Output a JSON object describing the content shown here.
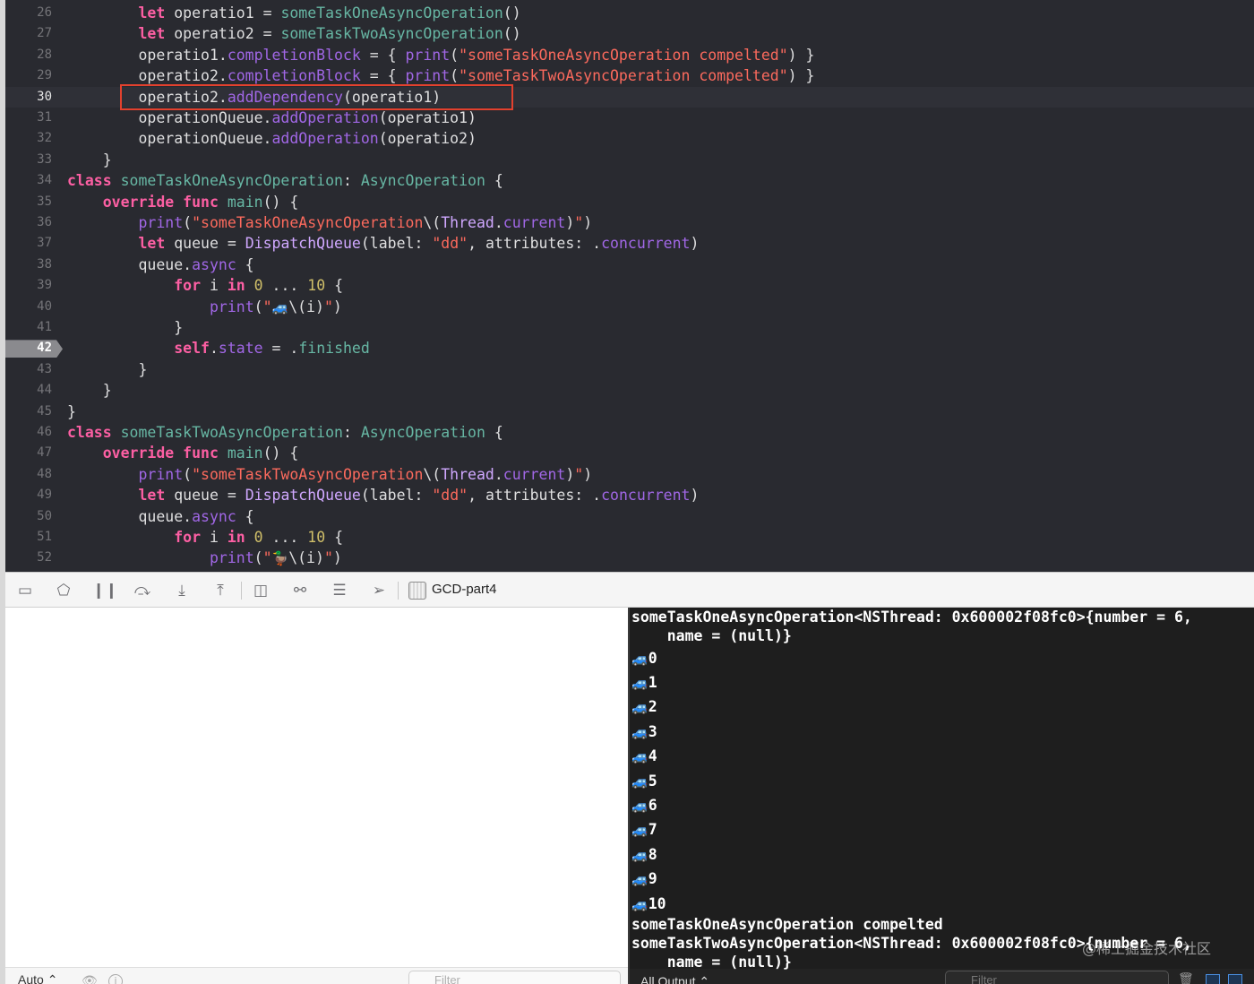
{
  "editor": {
    "lines": [
      {
        "n": "26",
        "tokens": [
          [
            "",
            "        "
          ],
          [
            "kw",
            "let"
          ],
          [
            "",
            " operatio1 = "
          ],
          [
            "ufunc",
            "someTaskOneAsyncOperation"
          ],
          [
            "",
            "()"
          ]
        ]
      },
      {
        "n": "27",
        "tokens": [
          [
            "",
            "        "
          ],
          [
            "kw",
            "let"
          ],
          [
            "",
            " operatio2 = "
          ],
          [
            "ufunc",
            "someTaskTwoAsyncOperation"
          ],
          [
            "",
            "()"
          ]
        ]
      },
      {
        "n": "28",
        "tokens": [
          [
            "",
            "        operatio1."
          ],
          [
            "prop",
            "completionBlock"
          ],
          [
            "",
            " = { "
          ],
          [
            "method",
            "print"
          ],
          [
            "",
            "("
          ],
          [
            "str",
            "\"someTaskOneAsyncOperation compelted\""
          ],
          [
            "",
            ") }"
          ]
        ]
      },
      {
        "n": "29",
        "tokens": [
          [
            "",
            "        operatio2."
          ],
          [
            "prop",
            "completionBlock"
          ],
          [
            "",
            " = { "
          ],
          [
            "method",
            "print"
          ],
          [
            "",
            "("
          ],
          [
            "str",
            "\"someTaskTwoAsyncOperation compelted\""
          ],
          [
            "",
            ") }"
          ]
        ]
      },
      {
        "n": "30",
        "current": true,
        "tokens": [
          [
            "",
            "        operatio2."
          ],
          [
            "method",
            "addDependency"
          ],
          [
            "",
            "(operatio1)"
          ]
        ]
      },
      {
        "n": "31",
        "tokens": [
          [
            "",
            "        operationQueue."
          ],
          [
            "method",
            "addOperation"
          ],
          [
            "",
            "(operatio1)"
          ]
        ]
      },
      {
        "n": "32",
        "tokens": [
          [
            "",
            "        operationQueue."
          ],
          [
            "method",
            "addOperation"
          ],
          [
            "",
            "(operatio2)"
          ]
        ]
      },
      {
        "n": "33",
        "tokens": [
          [
            "",
            "    }"
          ]
        ]
      },
      {
        "n": "34",
        "tokens": [
          [
            "kw",
            "class"
          ],
          [
            "",
            " "
          ],
          [
            "utype",
            "someTaskOneAsyncOperation"
          ],
          [
            "",
            ": "
          ],
          [
            "utype",
            "AsyncOperation"
          ],
          [
            "",
            " {"
          ]
        ]
      },
      {
        "n": "35",
        "tokens": [
          [
            "",
            "    "
          ],
          [
            "kw",
            "override"
          ],
          [
            "",
            " "
          ],
          [
            "kw",
            "func"
          ],
          [
            "",
            " "
          ],
          [
            "ufunc",
            "main"
          ],
          [
            "",
            "() {"
          ]
        ]
      },
      {
        "n": "36",
        "tokens": [
          [
            "",
            "        "
          ],
          [
            "method",
            "print"
          ],
          [
            "",
            "("
          ],
          [
            "str",
            "\"someTaskOneAsyncOperation"
          ],
          [
            "",
            "\\("
          ],
          [
            "otype",
            "Thread"
          ],
          [
            "",
            "."
          ],
          [
            "prop",
            "current"
          ],
          [
            "",
            ")"
          ],
          [
            "str",
            "\""
          ],
          [
            "",
            ")"
          ]
        ]
      },
      {
        "n": "37",
        "tokens": [
          [
            "",
            "        "
          ],
          [
            "kw",
            "let"
          ],
          [
            "",
            " queue = "
          ],
          [
            "otype",
            "DispatchQueue"
          ],
          [
            "",
            "(label: "
          ],
          [
            "str",
            "\"dd\""
          ],
          [
            "",
            ", attributes: ."
          ],
          [
            "prop",
            "concurrent"
          ],
          [
            "",
            ")"
          ]
        ]
      },
      {
        "n": "38",
        "tokens": [
          [
            "",
            "        queue."
          ],
          [
            "method",
            "async"
          ],
          [
            "",
            " {"
          ]
        ]
      },
      {
        "n": "39",
        "tokens": [
          [
            "",
            "            "
          ],
          [
            "kw",
            "for"
          ],
          [
            "",
            " i "
          ],
          [
            "kw",
            "in"
          ],
          [
            "",
            " "
          ],
          [
            "num",
            "0"
          ],
          [
            "",
            " ... "
          ],
          [
            "num",
            "10"
          ],
          [
            "",
            " {"
          ]
        ]
      },
      {
        "n": "40",
        "tokens": [
          [
            "",
            "                "
          ],
          [
            "method",
            "print"
          ],
          [
            "",
            "("
          ],
          [
            "str",
            "\""
          ],
          [
            "car",
            "🚙"
          ],
          [
            "",
            "\\(i)"
          ],
          [
            "str",
            "\""
          ],
          [
            "",
            ")"
          ]
        ]
      },
      {
        "n": "41",
        "tokens": [
          [
            "",
            "            }"
          ]
        ]
      },
      {
        "n": "42",
        "breakpoint": true,
        "tokens": [
          [
            "",
            "            "
          ],
          [
            "kw",
            "self"
          ],
          [
            "",
            "."
          ],
          [
            "prop",
            "state"
          ],
          [
            "",
            " = ."
          ],
          [
            "ufunc",
            "finished"
          ]
        ]
      },
      {
        "n": "43",
        "tokens": [
          [
            "",
            "        }"
          ]
        ]
      },
      {
        "n": "44",
        "tokens": [
          [
            "",
            "    }"
          ]
        ]
      },
      {
        "n": "45",
        "tokens": [
          [
            "",
            "}"
          ]
        ]
      },
      {
        "n": "46",
        "tokens": [
          [
            "kw",
            "class"
          ],
          [
            "",
            " "
          ],
          [
            "utype",
            "someTaskTwoAsyncOperation"
          ],
          [
            "",
            ": "
          ],
          [
            "utype",
            "AsyncOperation"
          ],
          [
            "",
            " {"
          ]
        ]
      },
      {
        "n": "47",
        "tokens": [
          [
            "",
            "    "
          ],
          [
            "kw",
            "override"
          ],
          [
            "",
            " "
          ],
          [
            "kw",
            "func"
          ],
          [
            "",
            " "
          ],
          [
            "ufunc",
            "main"
          ],
          [
            "",
            "() {"
          ]
        ]
      },
      {
        "n": "48",
        "tokens": [
          [
            "",
            "        "
          ],
          [
            "method",
            "print"
          ],
          [
            "",
            "("
          ],
          [
            "str",
            "\"someTaskTwoAsyncOperation"
          ],
          [
            "",
            "\\("
          ],
          [
            "otype",
            "Thread"
          ],
          [
            "",
            "."
          ],
          [
            "prop",
            "current"
          ],
          [
            "",
            ")"
          ],
          [
            "str",
            "\""
          ],
          [
            "",
            ")"
          ]
        ]
      },
      {
        "n": "49",
        "tokens": [
          [
            "",
            "        "
          ],
          [
            "kw",
            "let"
          ],
          [
            "",
            " queue = "
          ],
          [
            "otype",
            "DispatchQueue"
          ],
          [
            "",
            "(label: "
          ],
          [
            "str",
            "\"dd\""
          ],
          [
            "",
            ", attributes: ."
          ],
          [
            "prop",
            "concurrent"
          ],
          [
            "",
            ")"
          ]
        ]
      },
      {
        "n": "50",
        "tokens": [
          [
            "",
            "        queue."
          ],
          [
            "method",
            "async"
          ],
          [
            "",
            " {"
          ]
        ]
      },
      {
        "n": "51",
        "tokens": [
          [
            "",
            "            "
          ],
          [
            "kw",
            "for"
          ],
          [
            "",
            " i "
          ],
          [
            "kw",
            "in"
          ],
          [
            "",
            " "
          ],
          [
            "num",
            "0"
          ],
          [
            "",
            " ... "
          ],
          [
            "num",
            "10"
          ],
          [
            "",
            " {"
          ]
        ]
      },
      {
        "n": "52",
        "tokens": [
          [
            "",
            "                "
          ],
          [
            "method",
            "print"
          ],
          [
            "",
            "("
          ],
          [
            "str",
            "\""
          ],
          [
            "car",
            "🦆"
          ],
          [
            "",
            "\\(i)"
          ],
          [
            "str",
            "\""
          ],
          [
            "",
            ")"
          ]
        ]
      }
    ]
  },
  "debugbar": {
    "target": "GCD-part4",
    "icons": [
      "hide-debug-area-icon",
      "breakpoints-toggle-icon",
      "pause-icon",
      "step-over-icon",
      "step-into-icon",
      "step-out-icon",
      "view-hierarchy-icon",
      "memory-graph-icon",
      "environment-overrides-icon",
      "simulate-location-icon"
    ]
  },
  "variables": {
    "scope": "Auto ⌃",
    "filter_placeholder": "Filter"
  },
  "console": {
    "lines": [
      "someTaskOneAsyncOperation<NSThread: 0x600002f08fc0>{number = 6,",
      "    name = (null)}",
      "0",
      "1",
      "2",
      "3",
      "4",
      "5",
      "6",
      "7",
      "8",
      "9",
      "10",
      "someTaskOneAsyncOperation compelted",
      "someTaskTwoAsyncOperation<NSThread: 0x600002f08fc0>{number = 6,",
      "    name = (null)}"
    ],
    "car_glyph": "🚙",
    "output_selector": "All Output ⌃",
    "filter_placeholder": "Filter",
    "watermark": "@稀土掘金技术社区"
  },
  "colors": {
    "editor_bg": "#292a30",
    "console_bg": "#1e1e1e",
    "highlight_box": "#e2412e",
    "keyword": "#fc5fa3",
    "string": "#fc6a5d",
    "number": "#d0bf69"
  }
}
